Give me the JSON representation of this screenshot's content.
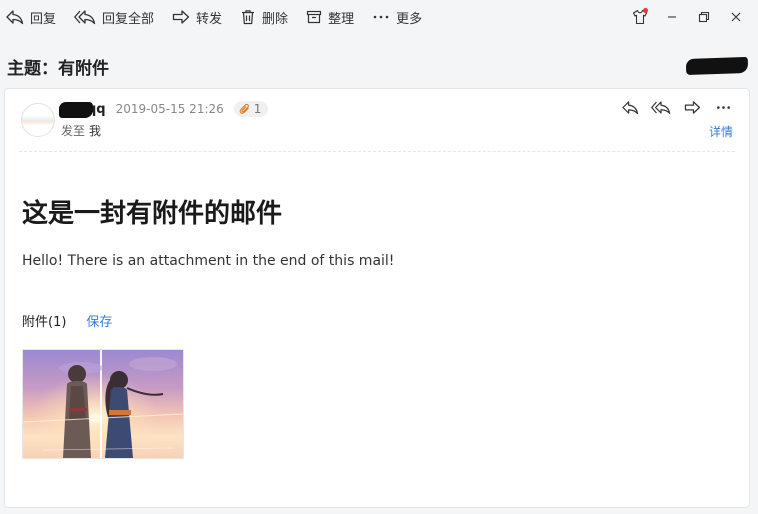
{
  "toolbar": {
    "reply": "回复",
    "reply_all": "回复全部",
    "forward": "转发",
    "delete": "删除",
    "organize": "整理",
    "more": "更多"
  },
  "subject": "主题：有附件",
  "mail": {
    "sender": "qq",
    "date": "2019-05-15 21:26",
    "attachment_count": "1",
    "to_label": "发至",
    "to_value": "我",
    "details": "详情",
    "title": "这是一封有附件的邮件",
    "body": "Hello! There is an attachment in the end of this mail!",
    "attachments_label": "附件(1)",
    "save_label": "保存"
  },
  "colors": {
    "link": "#3a7bd5",
    "notification_dot": "#e53935"
  }
}
